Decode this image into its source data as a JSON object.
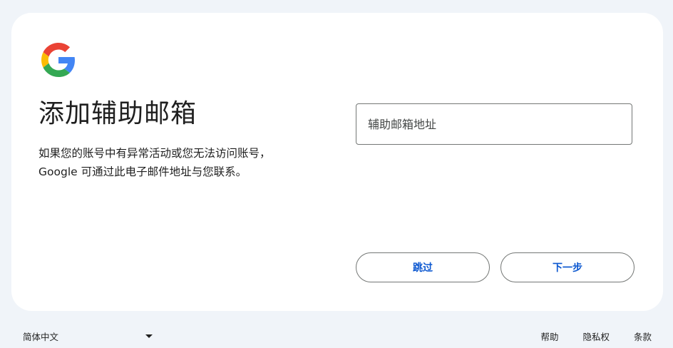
{
  "header": {
    "logo_icon": "google-g-logo"
  },
  "main": {
    "title": "添加辅助邮箱",
    "description_line1": "如果您的账号中有异常活动或您无法访问账号，",
    "description_line2": "Google 可通过此电子邮件地址与您联系。"
  },
  "form": {
    "email_placeholder": "辅助邮箱地址",
    "email_value": ""
  },
  "actions": {
    "skip_label": "跳过",
    "next_label": "下一步"
  },
  "footer": {
    "language": "简体中文",
    "help": "帮助",
    "privacy": "隐私权",
    "terms": "条款"
  },
  "colors": {
    "page_background": "#f0f4f9",
    "card_background": "#ffffff",
    "button_text": "#0b57d0",
    "border": "#747775"
  }
}
